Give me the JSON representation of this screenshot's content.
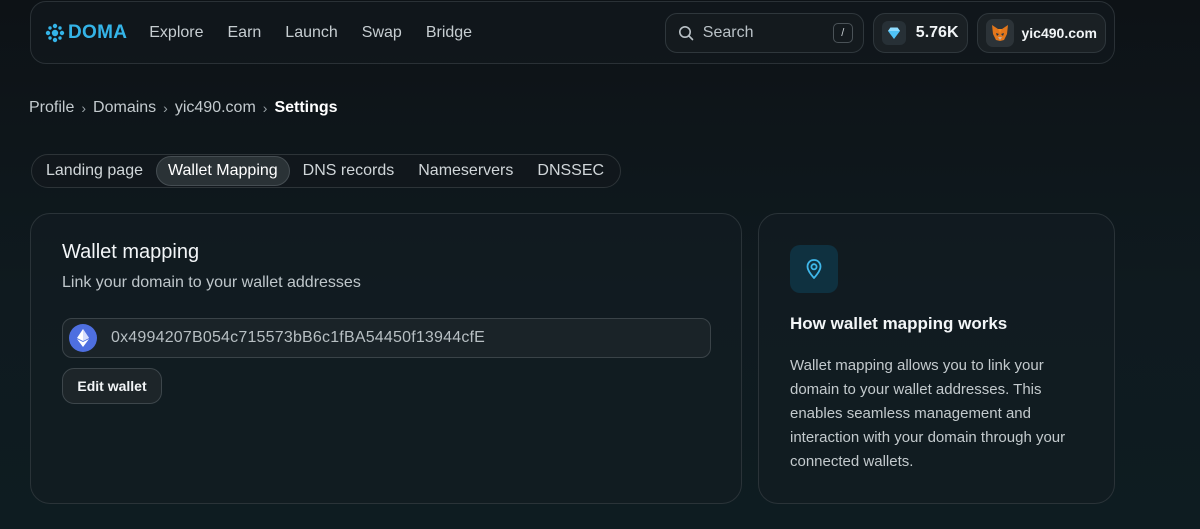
{
  "brand": {
    "name": "DOMA",
    "color": "#34b4e8"
  },
  "nav": {
    "links": [
      "Explore",
      "Earn",
      "Launch",
      "Swap",
      "Bridge"
    ],
    "search": {
      "placeholder": "Search",
      "shortcut": "/"
    },
    "points": {
      "icon": "gem-icon",
      "value": "5.76K"
    },
    "account": {
      "icon": "fox-icon",
      "name": "yic490.com"
    }
  },
  "breadcrumb": {
    "items": [
      "Profile",
      "Domains",
      "yic490.com"
    ],
    "current": "Settings"
  },
  "tabs": [
    {
      "label": "Landing page",
      "active": false
    },
    {
      "label": "Wallet Mapping",
      "active": true
    },
    {
      "label": "DNS records",
      "active": false
    },
    {
      "label": "Nameservers",
      "active": false
    },
    {
      "label": "DNSSEC",
      "active": false
    }
  ],
  "wallet_mapping": {
    "title": "Wallet mapping",
    "subtitle": "Link your domain to your wallet addresses",
    "address_icon": "ethereum-icon",
    "address": "0x4994207B054c715573bB6c1fBA54450f13944cfE",
    "edit_label": "Edit wallet"
  },
  "info": {
    "icon": "map-pin-icon",
    "title": "How wallet mapping works",
    "body": "Wallet mapping allows you to link your domain to your wallet addresses. This enables seamless management and interaction with your domain through your connected wallets."
  }
}
